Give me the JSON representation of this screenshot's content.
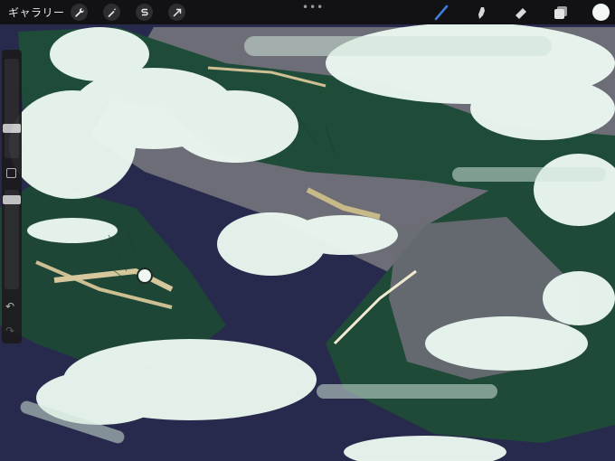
{
  "app": {
    "gallery_label": "ギャラリー"
  },
  "toolbar": {
    "left_tools": [
      "wrench-icon",
      "magic-wand-icon",
      "selection-icon",
      "transform-arrow-icon"
    ],
    "more_label": "•••",
    "right_tools": [
      "brush-icon",
      "smudge-icon",
      "eraser-icon",
      "layers-icon"
    ],
    "active_tool": "brush",
    "current_color": "#f2f6f4"
  },
  "sidebar": {
    "brush_size": 0.7,
    "opacity": 0.95,
    "undo_icon": "undo-icon",
    "redo_icon": "redo-icon"
  },
  "colors": {
    "canvas_bg": "#26284a",
    "dark_green": "#1f4a38",
    "gray": "#6d6e77",
    "cloud": "#eef9f2",
    "accent_blue": "#3d7dd8"
  }
}
